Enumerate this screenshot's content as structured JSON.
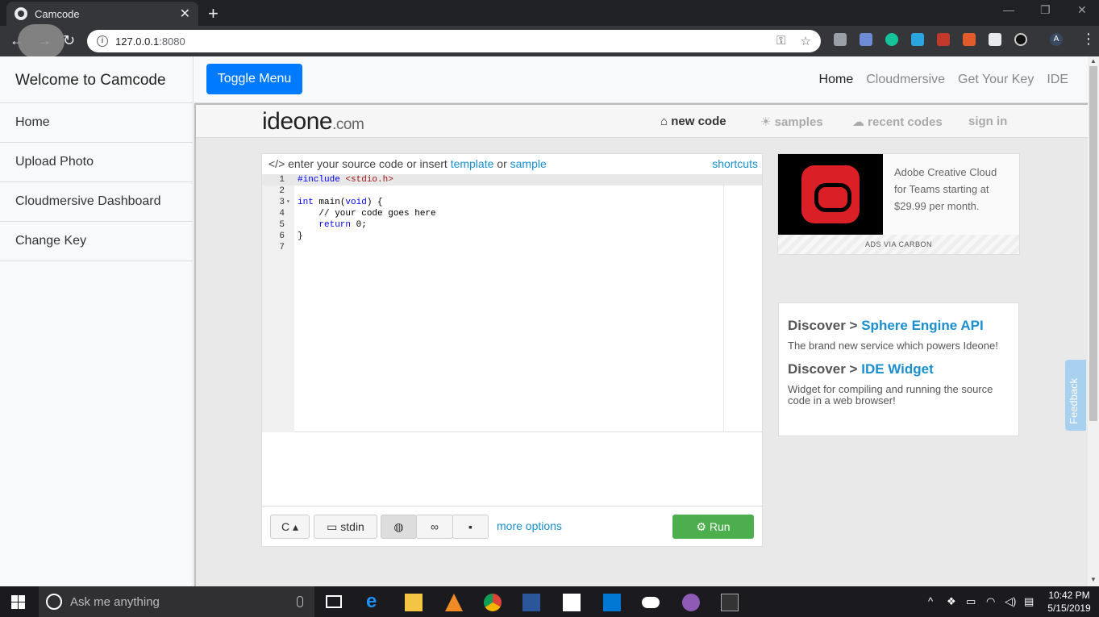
{
  "browser": {
    "tab_title": "Camcode",
    "url_host": "127.0.0.1",
    "url_port": ":8080",
    "profile_initial": "A"
  },
  "sidebar": {
    "title": "Welcome to Camcode",
    "items": [
      {
        "label": "Home"
      },
      {
        "label": "Upload Photo"
      },
      {
        "label": "Cloudmersive Dashboard"
      },
      {
        "label": "Change Key"
      }
    ]
  },
  "topnav": {
    "toggle_label": "Toggle Menu",
    "links": [
      {
        "label": "Home"
      },
      {
        "label": "Cloudmersive"
      },
      {
        "label": "Get Your Key"
      },
      {
        "label": "IDE"
      }
    ]
  },
  "ideone": {
    "logo_main": "ideone",
    "logo_suffix": ".com",
    "nav": [
      {
        "label": "new code",
        "icon": "home-icon"
      },
      {
        "label": "samples",
        "icon": "lightbulb-icon"
      },
      {
        "label": "recent codes",
        "icon": "cloud-icon"
      },
      {
        "label": "sign in"
      }
    ],
    "editor": {
      "prompt_prefix": "enter your source code or insert",
      "template_link": "template",
      "or_text": "or",
      "sample_link": "sample",
      "shortcuts_link": "shortcuts",
      "lines": [
        {
          "num": "1",
          "text": "#include <stdio.h>"
        },
        {
          "num": "2",
          "text": ""
        },
        {
          "num": "3",
          "text": "int main(void) {"
        },
        {
          "num": "4",
          "text": "    // your code goes here"
        },
        {
          "num": "5",
          "text": "    return 0;"
        },
        {
          "num": "6",
          "text": "}"
        },
        {
          "num": "7",
          "text": ""
        }
      ]
    },
    "footer": {
      "language": "C",
      "stdin_label": "stdin",
      "more_options": "more options",
      "run_label": "Run"
    },
    "ad": {
      "text": "Adobe Creative Cloud for Teams starting at $29.99 per month.",
      "via": "ADS VIA CARBON"
    },
    "discover": [
      {
        "prefix": "Discover >",
        "link": "Sphere Engine API",
        "desc": "The brand new service which powers Ideone!"
      },
      {
        "prefix": "Discover >",
        "link": "IDE Widget",
        "desc": "Widget for compiling and running the source code in a web browser!"
      }
    ],
    "feedback": "Feedback"
  },
  "taskbar": {
    "search_placeholder": "Ask me anything",
    "time": "10:42 PM",
    "date": "5/15/2019"
  },
  "colors": {
    "accent_blue": "#007bff",
    "link_blue": "#1a8fcf",
    "run_green": "#4cae4c"
  }
}
